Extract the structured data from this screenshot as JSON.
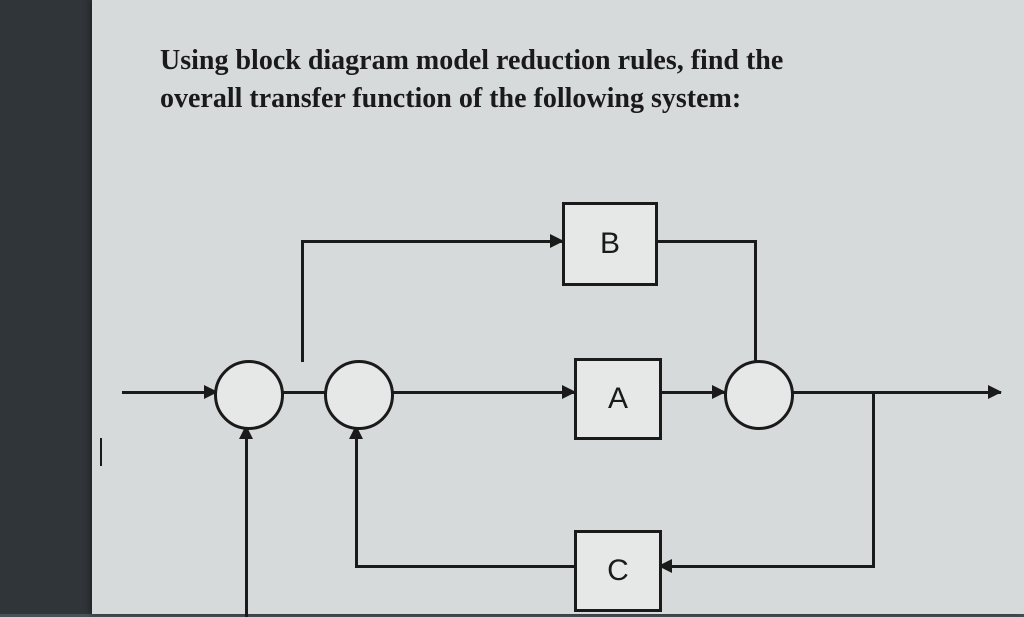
{
  "prompt": {
    "line1": "Using block diagram model reduction rules, find the",
    "line2": "overall transfer function of the following system:"
  },
  "blocks": {
    "A": "A",
    "B": "B",
    "C": "C"
  },
  "diagram_structure": {
    "description": "Block diagram for transfer function reduction problem",
    "summing_junctions": 3,
    "blocks": [
      "A",
      "B",
      "C"
    ],
    "paths": {
      "input": "enters summing junction 1 from left",
      "forward_main": "sum1 -> sum2 -> A -> sum3 -> output",
      "feedforward_B": "branch after sum1 -> B -> into sum3",
      "feedback_C": "branch from output -> C -> into sum2",
      "feedback_unity": "branch from output -> into sum1"
    }
  }
}
